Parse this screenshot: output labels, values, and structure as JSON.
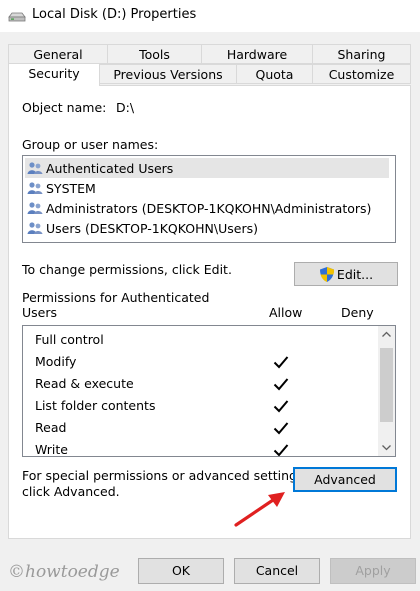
{
  "window": {
    "title": "Local Disk (D:) Properties"
  },
  "tabs_back": [
    {
      "label": "General"
    },
    {
      "label": "Tools"
    },
    {
      "label": "Hardware"
    },
    {
      "label": "Sharing"
    }
  ],
  "tabs_front": [
    {
      "label": "Security",
      "active": true
    },
    {
      "label": "Previous Versions"
    },
    {
      "label": "Quota"
    },
    {
      "label": "Customize"
    }
  ],
  "object": {
    "label": "Object name:",
    "value": "D:\\"
  },
  "groups": {
    "label": "Group or user names:",
    "items": [
      {
        "name": "Authenticated Users",
        "selected": true
      },
      {
        "name": "SYSTEM"
      },
      {
        "name": "Administrators (DESKTOP-1KQKOHN\\Administrators)"
      },
      {
        "name": "Users (DESKTOP-1KQKOHN\\Users)"
      }
    ]
  },
  "change": {
    "text": "To change permissions, click Edit.",
    "edit_label": "Edit..."
  },
  "permissions": {
    "heading_line1": "Permissions for Authenticated",
    "heading_line2": "Users",
    "allow_header": "Allow",
    "deny_header": "Deny",
    "rows": [
      {
        "name": "Full control",
        "allow": false
      },
      {
        "name": "Modify",
        "allow": true
      },
      {
        "name": "Read & execute",
        "allow": true
      },
      {
        "name": "List folder contents",
        "allow": true
      },
      {
        "name": "Read",
        "allow": true
      },
      {
        "name": "Write",
        "allow": true
      }
    ]
  },
  "advanced": {
    "text_line1": "For special permissions or advanced settings,",
    "text_line2": "click Advanced.",
    "button_label": "Advanced"
  },
  "footer": {
    "ok_label": "OK",
    "cancel_label": "Cancel",
    "apply_label": "Apply",
    "watermark": "©howtoedge"
  },
  "colors": {
    "accent": "#0078d7",
    "arrow": "#e02020",
    "shield_blue": "#2f6fd6",
    "shield_yellow": "#f2c200"
  }
}
